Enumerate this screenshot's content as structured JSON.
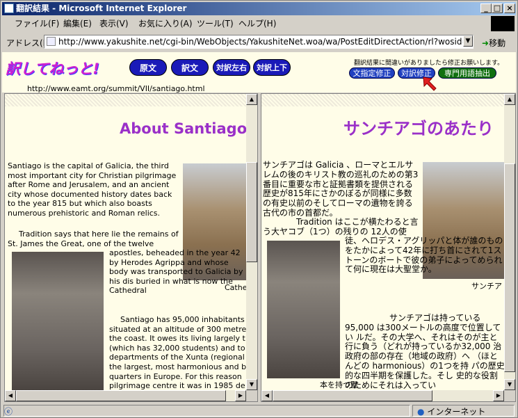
{
  "window": {
    "title": "翻訳結果 - Microsoft Internet Explorer",
    "min": "_",
    "max": "□",
    "close": "×"
  },
  "menu": [
    "ファイル(F)",
    "編集(E)",
    "表示(V)",
    "お気に入り(A)",
    "ツール(T)",
    "ヘルプ(H)"
  ],
  "address": {
    "label": "アドレス(D)",
    "url": "http://www.yakushite.net/cgi-bin/WebObjects/YakushiteNet.woa/wa/PostEditDirectAction/rl?wosid=Ah2Me7jwl",
    "go": "移動"
  },
  "app": {
    "logo": "訳してねっと!",
    "buttons": [
      "原文",
      "訳文",
      "対訳左右",
      "対訳上下"
    ],
    "note": "翻訳結果に間違いがありましたら修正お願いします。",
    "small_buttons": [
      "文指定修正",
      "対訳修正",
      "専門用語抽出"
    ],
    "source_url": "http://www.eamt.org/summit/VII/santiago.html"
  },
  "left": {
    "heading": "About Santiago",
    "p1": "Santiago is the capital of Galicia, the third most important city for Christian pilgrimage after Rome and Jerusalem, and an ancient city whose documented history dates back to the year 815 but which also boasts numerous prehistoric and Roman relics.",
    "p2a": "Tradition says that here lie the remains of St. James the Great, one of the twelve",
    "p2b": "apostles, beheaded in the year 42 by Herodes Agrippa and whose body was transported to Galicia by his dis buried in what is now the Cathedral",
    "p3": "Santiago has 95,000 inhabitants situated at an altitude of 300 metre the coast. It owes its living largely t (which has 32,000 students) and to departments of the Xunta (regional the largest, most harmonious and b quarters in Europe. For this reason pilgrimage centre it was in 1985 de",
    "caption": "Cathec"
  },
  "right": {
    "heading": "サンチアゴのあたり",
    "p1": "サンチアゴは Galicia 、ローマとエルサレムの後のキリスト教の巡礼のための第3番目に重要な市と証拠書類を提供される歴史が815年にさかのぼるが同様に多数の有史以前のそしてローマの遺物を誇る古代の市の首都だ。",
    "p2a": "Tradition はここが横たわると言う大ヤコブ（1つ）の残りの 12人の使",
    "p2b": "徒、ヘロデス・アグリッパと体が誰のものをたかによって42年に打ち首にされて1ストーンのボートで彼の弟子によってめられて何に現在は大聖堂か。",
    "p3": "サンチアゴは持っている95,000 は300メートルの高度で位置してい ルだ。その大学へ、それはそのが主と 行に負う（どれが持っているか32,000 治政府の部の存在（地域の政府）ヘ （ほとんどの harmonious）の1つを持 パの歴史的な四半期を保護した。そし 史的な役割のためにそれは入ってい",
    "caption": "サンチア",
    "caption2": "本を持つ聖"
  },
  "status": {
    "zone": "インターネット"
  }
}
